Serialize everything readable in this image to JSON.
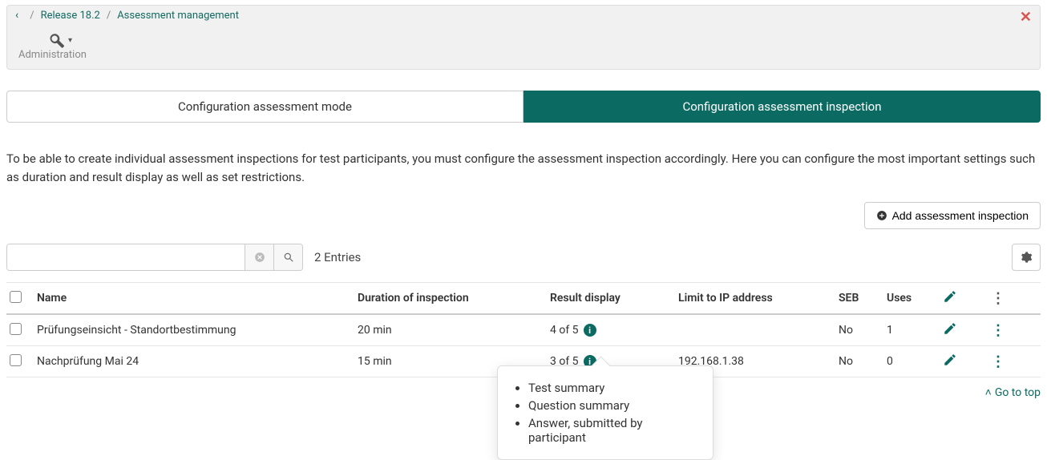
{
  "breadcrumb": {
    "release": "Release 18.2",
    "current": "Assessment management"
  },
  "admin": {
    "label": "Administration"
  },
  "tabs": {
    "mode": "Configuration assessment mode",
    "inspection": "Configuration assessment inspection"
  },
  "intro": "To be able to create individual assessment inspections for test participants, you must configure the assessment inspection accordingly. Here you can configure the most important settings such as duration and result display as well as set restrictions.",
  "buttons": {
    "add": "Add assessment inspection"
  },
  "toolbar": {
    "entries": "2 Entries"
  },
  "columns": {
    "name": "Name",
    "duration": "Duration of inspection",
    "result": "Result display",
    "ip": "Limit to IP address",
    "seb": "SEB",
    "uses": "Uses"
  },
  "rows": [
    {
      "name": "Prüfungseinsicht - Standortbestimmung",
      "duration": "20 min",
      "result": "4 of 5",
      "ip": "",
      "seb": "No",
      "uses": "1"
    },
    {
      "name": "Nachprüfung Mai 24",
      "duration": "15 min",
      "result": "3 of 5",
      "ip": "192.168.1.38",
      "seb": "No",
      "uses": "0"
    }
  ],
  "popover": {
    "items": [
      "Test summary",
      "Question summary",
      "Answer, submitted by participant"
    ]
  },
  "footer": {
    "gotop": "Go to top"
  }
}
